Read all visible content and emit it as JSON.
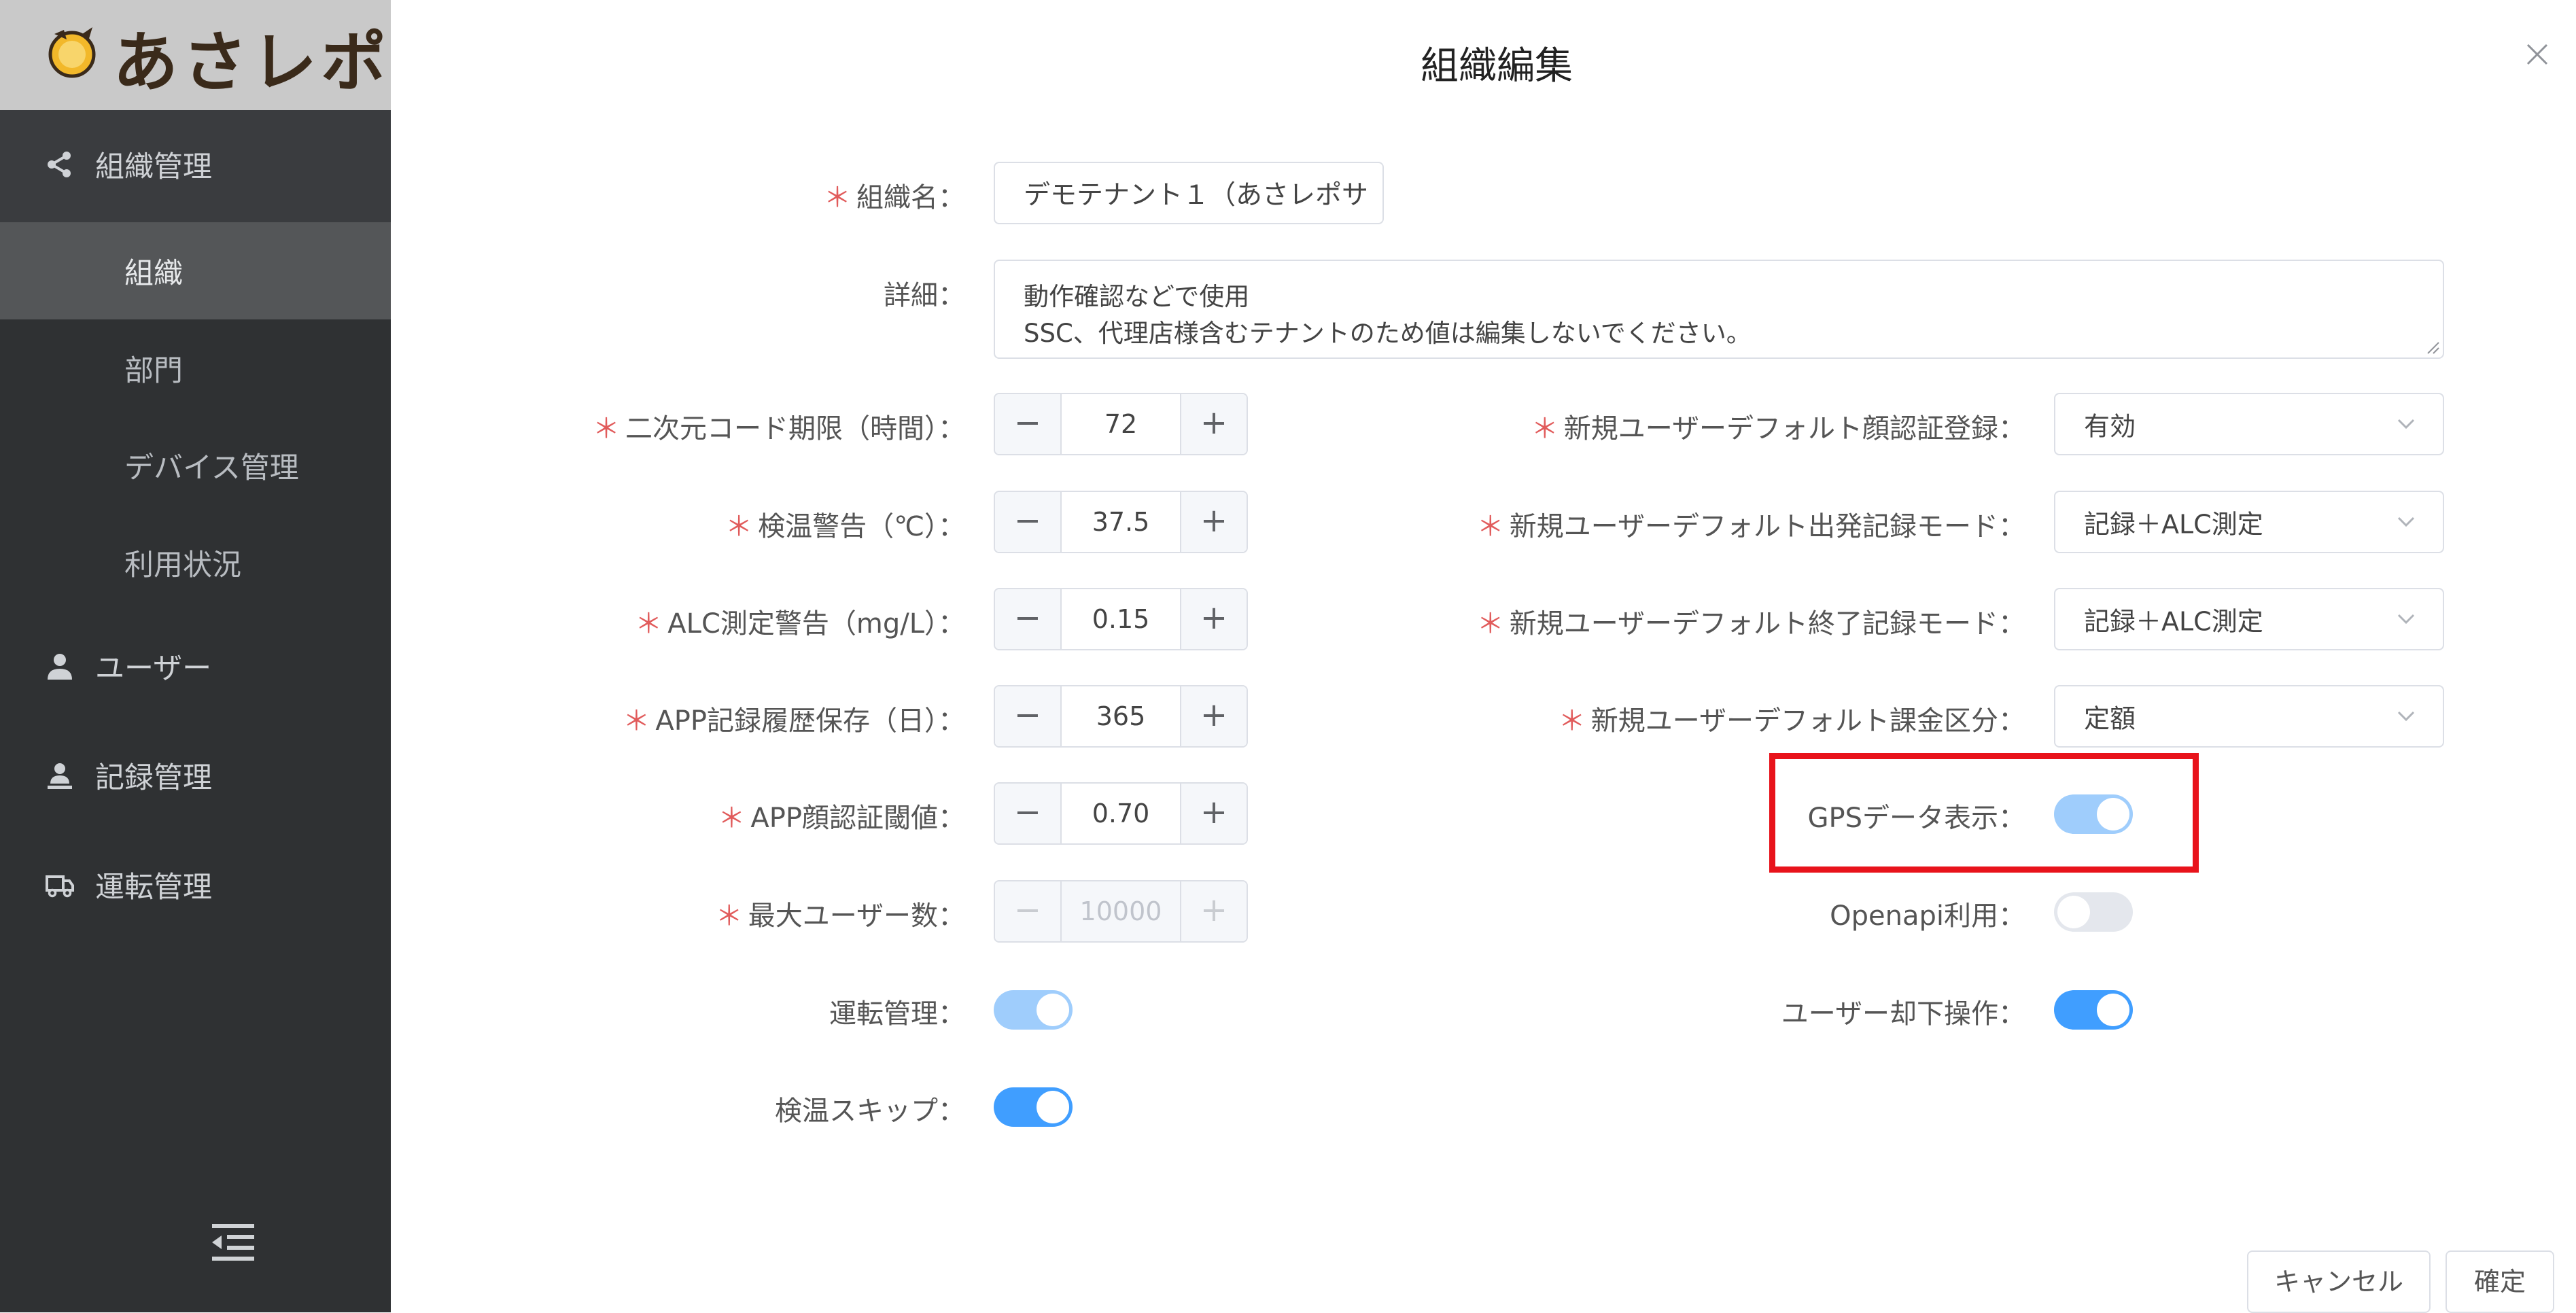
{
  "app": {
    "logo_text": "あさレポ"
  },
  "sidebar": {
    "org_management": {
      "label": "組織管理",
      "icon": "share-icon"
    },
    "sub_items": [
      {
        "label": "組織",
        "active": true
      },
      {
        "label": "部門"
      },
      {
        "label": "デバイス管理"
      },
      {
        "label": "利用状況"
      }
    ],
    "users": {
      "label": "ユーザー",
      "icon": "user-icon"
    },
    "records": {
      "label": "記録管理",
      "icon": "user-record-icon"
    },
    "driving": {
      "label": "運転管理",
      "icon": "truck-icon"
    }
  },
  "dialog": {
    "title": "組織編集",
    "org_name": {
      "label": "組織名：",
      "value": "デモテナント１（あさレポサ",
      "required": true
    },
    "detail": {
      "label": "詳細：",
      "line1": "動作確認などで使用",
      "line2": "SSC、代理店様含むテナントのため値は編集しないでください。"
    },
    "qr_expiry": {
      "label": "二次元コード期限（時間）：",
      "value": "72"
    },
    "temp_warning": {
      "label": "検温警告（℃）：",
      "value": "37.5"
    },
    "alc_warning": {
      "label": "ALC測定警告（mg/L）：",
      "value": "0.15"
    },
    "app_history": {
      "label": "APP記録履歴保存（日）：",
      "value": "365"
    },
    "app_face_threshold": {
      "label": "APP顔認証閾値：",
      "value": "0.70"
    },
    "max_users": {
      "label": "最大ユーザー数：",
      "value": "10000"
    },
    "driving_mgmt": {
      "label": "運転管理：",
      "on": true
    },
    "temp_skip": {
      "label": "検温スキップ：",
      "on": true
    },
    "default_face_reg": {
      "label": "新規ユーザーデフォルト顔認証登録：",
      "value": "有効"
    },
    "default_depart_mode": {
      "label": "新規ユーザーデフォルト出発記録モード：",
      "value": "記録＋ALC測定"
    },
    "default_end_mode": {
      "label": "新規ユーザーデフォルト終了記録モード：",
      "value": "記録＋ALC測定"
    },
    "default_billing": {
      "label": "新規ユーザーデフォルト課金区分：",
      "value": "定額"
    },
    "gps_display": {
      "label": "GPSデータ表示：",
      "on": true
    },
    "openapi": {
      "label": "Openapi利用：",
      "on": false
    },
    "user_reject": {
      "label": "ユーザー却下操作：",
      "on": true
    },
    "required_mark": "＊",
    "minus": "−",
    "plus": "+",
    "cancel_label": "キャンセル",
    "confirm_label": "確定"
  },
  "colors": {
    "sidebar_bg": "#2f3133",
    "accent": "#409eff",
    "highlight": "#e8131b",
    "required": "#e15b5b"
  }
}
